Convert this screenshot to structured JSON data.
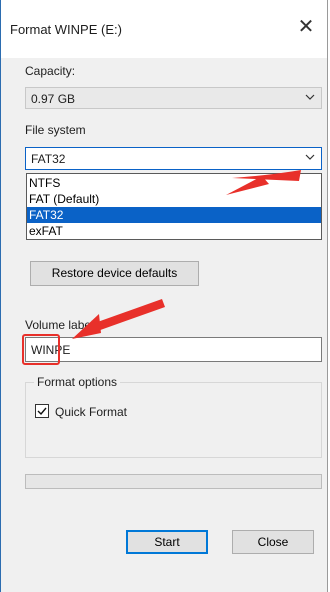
{
  "window": {
    "title": "Format WINPE (E:)"
  },
  "capacity": {
    "label": "Capacity:",
    "value": "0.97 GB"
  },
  "file_system": {
    "label": "File system",
    "value": "FAT32",
    "options": [
      {
        "label": "NTFS",
        "selected": false
      },
      {
        "label": "FAT (Default)",
        "selected": false
      },
      {
        "label": "FAT32",
        "selected": true
      },
      {
        "label": "exFAT",
        "selected": false
      }
    ]
  },
  "restore_button": {
    "label": "Restore device defaults"
  },
  "volume_label": {
    "label": "Volume label",
    "value": "WINPE"
  },
  "format_options": {
    "label": "Format options",
    "quick_format_label": "Quick Format",
    "quick_format_checked": true
  },
  "progress": {
    "value": 0
  },
  "buttons": {
    "start": "Start",
    "close": "Close"
  },
  "colors": {
    "selection": "#0a62c7",
    "annotation": "#e8302a",
    "focus_border": "#0078d7"
  }
}
